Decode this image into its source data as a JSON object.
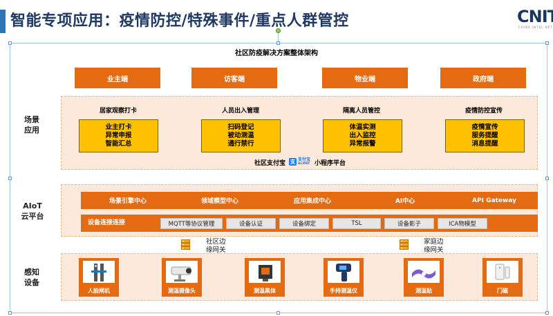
{
  "slide": {
    "title": "智能专项应用：疫情防控/特殊事件/重点人群管控"
  },
  "logo": {
    "text": "CNIT",
    "subtitle": "CHINA INTEL NET"
  },
  "diagram": {
    "title": "社区防疫解决方案整体架构"
  },
  "roles": [
    "业主端",
    "访客端",
    "物业端",
    "政府端"
  ],
  "scene_layer": {
    "label": [
      "场景",
      "应用"
    ],
    "scenes": [
      {
        "title": "居家观察打卡",
        "items": [
          "业主打卡",
          "异常申报",
          "智能汇总"
        ]
      },
      {
        "title": "人员出入管理",
        "items": [
          "扫码登记",
          "被动测温",
          "通行禁行"
        ]
      },
      {
        "title": "隔离人员管控",
        "items": [
          "体温实测",
          "出入监控",
          "异常报警"
        ]
      },
      {
        "title": "疫情防控宣传",
        "items": [
          "疫情宣传",
          "服务提醒",
          "消息提醒"
        ]
      }
    ],
    "platform_prefix": "社区支付宝",
    "platform_brand": [
      "支付宝",
      "ALIPAY"
    ],
    "platform_suffix": "小程序平台"
  },
  "cloud_layer": {
    "label": [
      "AIoT",
      "云平台"
    ],
    "modules": [
      "场景引擎中心",
      "领域模型中心",
      "应用集成中心",
      "AI中心",
      "API Gateway"
    ],
    "connection_label": "设备连接连接",
    "protocols": [
      "MQTT等协议管理",
      "设备认证",
      "设备绑定",
      "TSL",
      "设备影子",
      "ICA物模型"
    ]
  },
  "gateways": [
    {
      "lines": [
        "社区边",
        "缘网关"
      ]
    },
    {
      "lines": [
        "家庭边",
        "缘网关"
      ]
    }
  ],
  "device_layer": {
    "label": [
      "感知",
      "设备"
    ],
    "devices": [
      "人脸闸机",
      "测温摄像头",
      "测温黑体",
      "手持测温仪",
      "测温贴",
      "门磁"
    ]
  },
  "colors": {
    "accent": "#e56b13",
    "highlight": "#ffc000",
    "layer_bg": "#fde9d9",
    "title": "#1f3864"
  }
}
